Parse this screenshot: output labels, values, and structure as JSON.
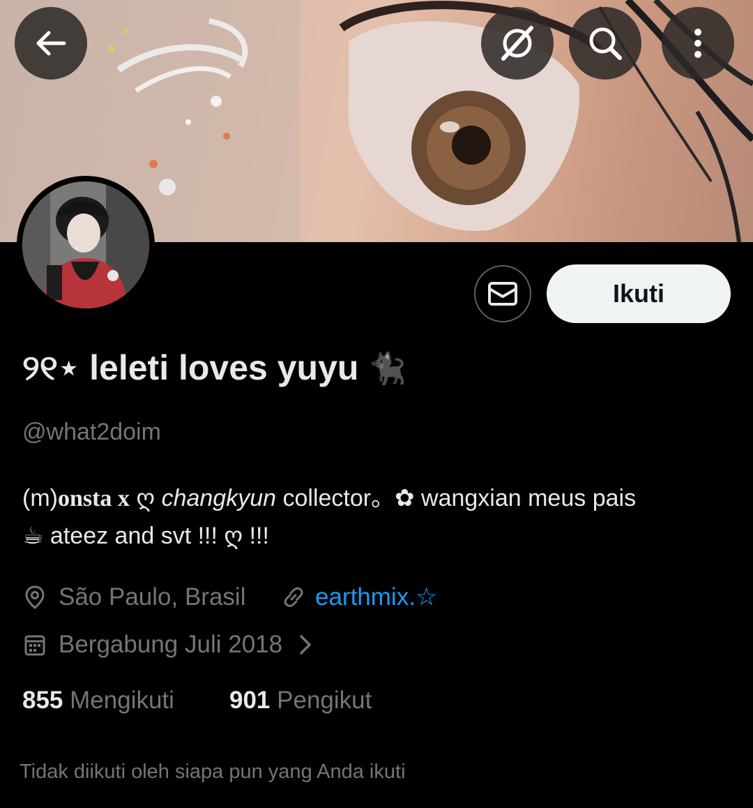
{
  "header": {
    "back_icon": "arrow-left-icon",
    "grok_icon": "grok-icon",
    "search_icon": "search-icon",
    "more_icon": "more-vertical-icon"
  },
  "profile": {
    "display_name": "୨୧⋆ leleti loves yuyu",
    "display_name_emoji": "🐈‍⬛",
    "handle": "@what2doim",
    "follow_label": "Ikuti",
    "message_icon": "envelope-icon"
  },
  "bio": {
    "line1_prefix": "(m)",
    "line1_styled": "onsta x",
    "line1_heart": " ღ ",
    "line1_italic": "changkyun",
    "line1_suffix": " collector。✿ wangxian meus pais",
    "line2": "☕ ateez and svt !!! ღ !!!"
  },
  "meta": {
    "location": "São Paulo, Brasil",
    "link": "earthmix.☆",
    "joined": "Bergabung Juli 2018",
    "link_color": "#1d9bf0"
  },
  "stats": {
    "following_count": "855",
    "following_label": "Mengikuti",
    "followers_count": "901",
    "followers_label": "Pengikut"
  },
  "followed_by_note": "Tidak diikuti oleh siapa pun yang Anda ikuti"
}
